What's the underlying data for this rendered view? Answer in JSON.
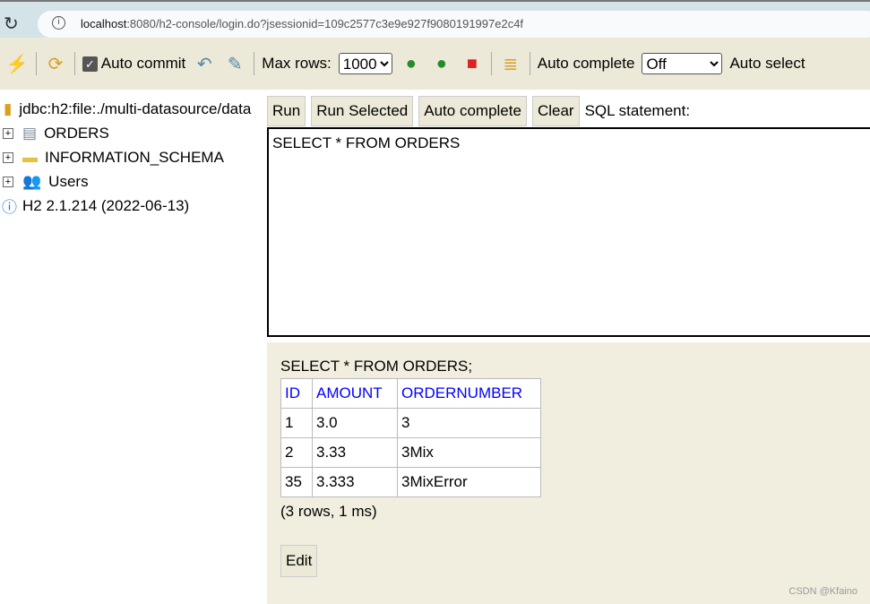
{
  "browser": {
    "url_host": "localhost",
    "url_rest": ":8080/h2-console/login.do?jsessionid=109c2577c3e9e927f9080191997e2c4f"
  },
  "toolbar": {
    "auto_commit": "Auto commit",
    "auto_commit_checked": true,
    "max_rows_label": "Max rows:",
    "max_rows": "1000",
    "auto_complete_label": "Auto complete",
    "auto_complete": "Off",
    "auto_select_label": "Auto select"
  },
  "tree": {
    "connection": "jdbc:h2:file:./multi-datasource/data",
    "items": [
      {
        "label": "ORDERS",
        "icon": "table-icon"
      },
      {
        "label": "INFORMATION_SCHEMA",
        "icon": "folder-icon"
      },
      {
        "label": "Users",
        "icon": "users-icon"
      }
    ],
    "version": "H2 2.1.214 (2022-06-13)"
  },
  "buttons": {
    "run": "Run",
    "run_selected": "Run Selected",
    "auto_complete": "Auto complete",
    "clear": "Clear",
    "sql_label": "SQL statement:"
  },
  "sql": "SELECT * FROM ORDERS",
  "result": {
    "statement": "SELECT * FROM ORDERS;",
    "columns": [
      "ID",
      "AMOUNT",
      "ORDERNUMBER"
    ],
    "rows": [
      [
        "1",
        "3.0",
        "3"
      ],
      [
        "2",
        "3.33",
        "3Mix"
      ],
      [
        "35",
        "3.333",
        "3MixError"
      ]
    ],
    "summary": "(3 rows, 1 ms)",
    "edit": "Edit"
  },
  "watermark": "CSDN @Kfaino"
}
